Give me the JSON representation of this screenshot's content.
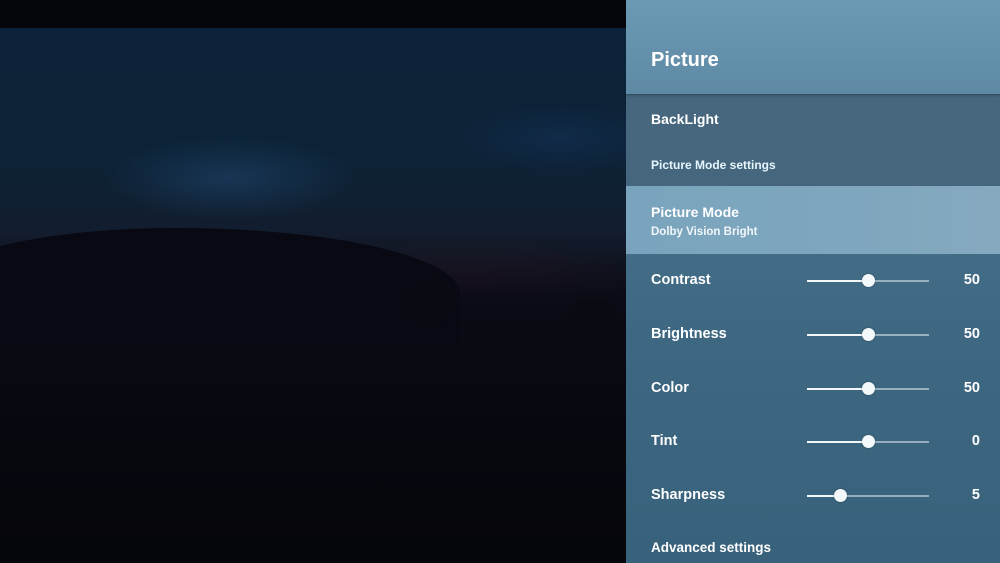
{
  "panel": {
    "title": "Picture",
    "backlight_label": "BackLight",
    "picture_mode_settings_label": "Picture Mode settings",
    "picture_mode": {
      "label": "Picture Mode",
      "value": "Dolby Vision Bright"
    },
    "sliders": [
      {
        "label": "Contrast",
        "value": "50",
        "level": 0.5
      },
      {
        "label": "Brightness",
        "value": "50",
        "level": 0.5
      },
      {
        "label": "Color",
        "value": "50",
        "level": 0.5
      },
      {
        "label": "Tint",
        "value": "0",
        "level": 0.5
      },
      {
        "label": "Sharpness",
        "value": "5",
        "level": 0.27
      }
    ],
    "advanced_settings_label": "Advanced settings"
  },
  "colors": {
    "panel_bg": "#48708b",
    "header_bg": "#6b98b3",
    "selected_row_bg": "#7ea6be",
    "text": "#ffffff"
  }
}
